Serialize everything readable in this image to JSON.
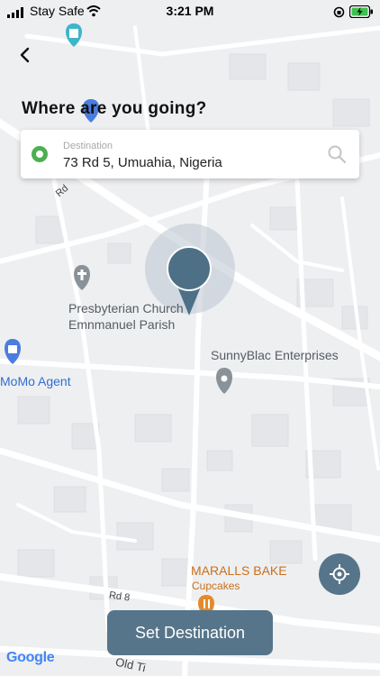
{
  "status_bar": {
    "carrier": "Stay Safe",
    "time": "3:21 PM"
  },
  "header": {
    "title": "Where are you going?"
  },
  "destination": {
    "label": "Destination",
    "value": "73 Rd 5, Umuahia, Nigeria"
  },
  "map": {
    "places": {
      "church_line1": "Presbyterian Church",
      "church_line2": "Emnmanuel Parish",
      "enterprise": "SunnyBlac Enterprises",
      "momo": "MoMo Agent",
      "bakery": "MARALLS BAKE",
      "bakery_sub": "Cupcakes"
    },
    "roads": {
      "rd": "Rd",
      "rd8": "Rd 8",
      "old": "Old Ti"
    },
    "attribution": "Google"
  },
  "actions": {
    "set_destination": "Set Destination"
  },
  "colors": {
    "accent": "#56758a",
    "pin": "#4d7086",
    "destination_dot": "#4caf50"
  }
}
